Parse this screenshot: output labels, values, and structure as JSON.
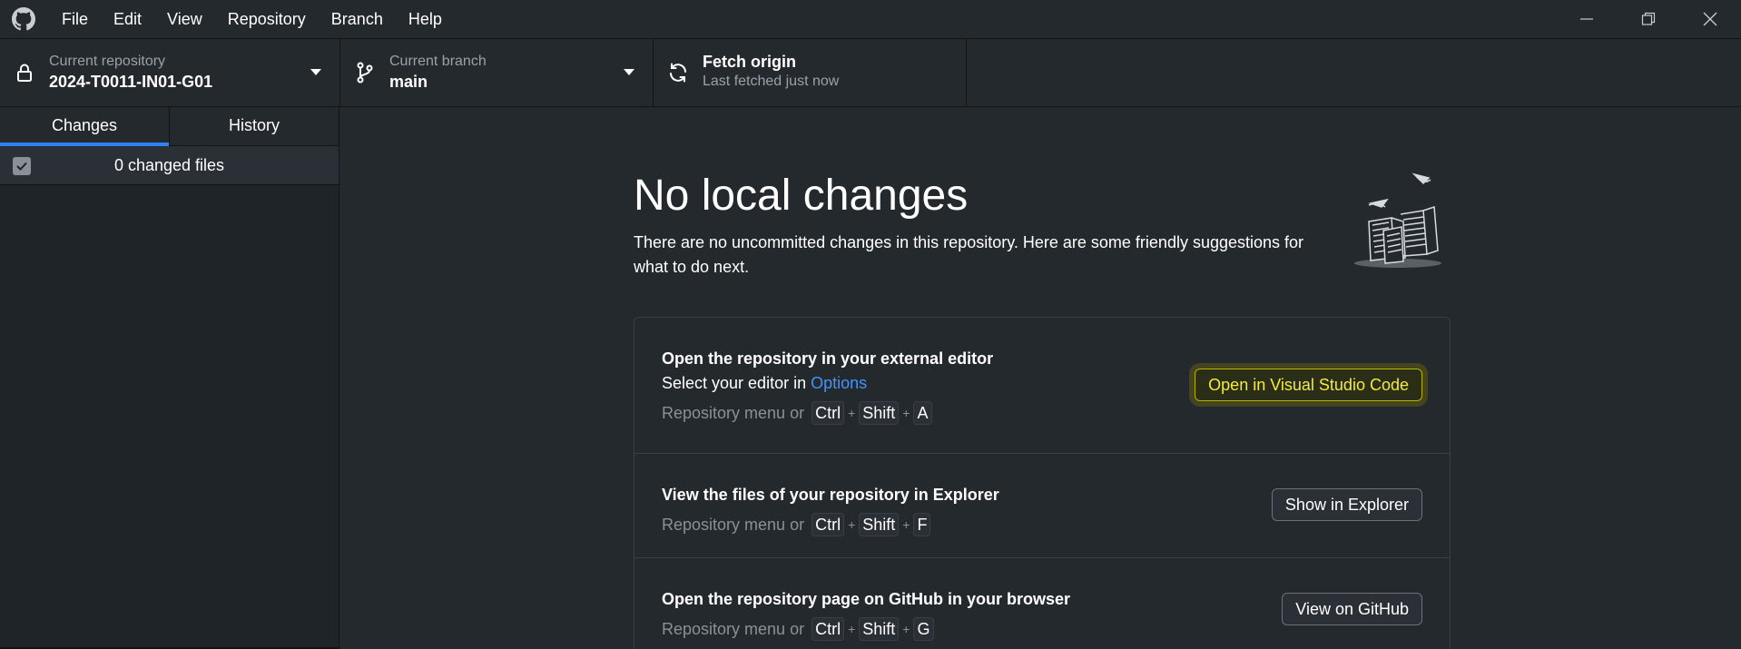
{
  "menu": {
    "items": [
      {
        "label": "File"
      },
      {
        "label": "Edit"
      },
      {
        "label": "View"
      },
      {
        "label": "Repository"
      },
      {
        "label": "Branch"
      },
      {
        "label": "Help"
      }
    ]
  },
  "toolbar": {
    "repo": {
      "title": "Current repository",
      "value": "2024-T0011-IN01-G01",
      "icon": "lock-icon"
    },
    "branch": {
      "title": "Current branch",
      "value": "main",
      "icon": "git-branch-icon"
    },
    "fetch": {
      "title": "Fetch origin",
      "value": "Last fetched just now",
      "icon": "sync-icon"
    }
  },
  "sidebar": {
    "tabs": [
      {
        "label": "Changes",
        "active": true
      },
      {
        "label": "History",
        "active": false
      }
    ],
    "changed_files_label": "0 changed files"
  },
  "main": {
    "heading": "No local changes",
    "description": "There are no uncommitted changes in this repository. Here are some friendly suggestions for what to do next.",
    "suggestions": [
      {
        "title": "Open the repository in your external editor",
        "subtitle_prefix": "Select your editor in ",
        "subtitle_link": "Options",
        "shortcut_lead": "Repository menu or",
        "keys": [
          "Ctrl",
          "Shift",
          "A"
        ],
        "button": "Open in Visual Studio Code"
      },
      {
        "title": "View the files of your repository in Explorer",
        "shortcut_lead": "Repository menu or",
        "keys": [
          "Ctrl",
          "Shift",
          "F"
        ],
        "button": "Show in Explorer"
      },
      {
        "title": "Open the repository page on GitHub in your browser",
        "shortcut_lead": "Repository menu or",
        "keys": [
          "Ctrl",
          "Shift",
          "G"
        ],
        "button": "View on GitHub"
      }
    ],
    "plus": "+"
  },
  "colors": {
    "background": "#24292e",
    "accent": "#2f81f7",
    "link": "#4493f8",
    "highlight_text": "#f4ea3e"
  }
}
